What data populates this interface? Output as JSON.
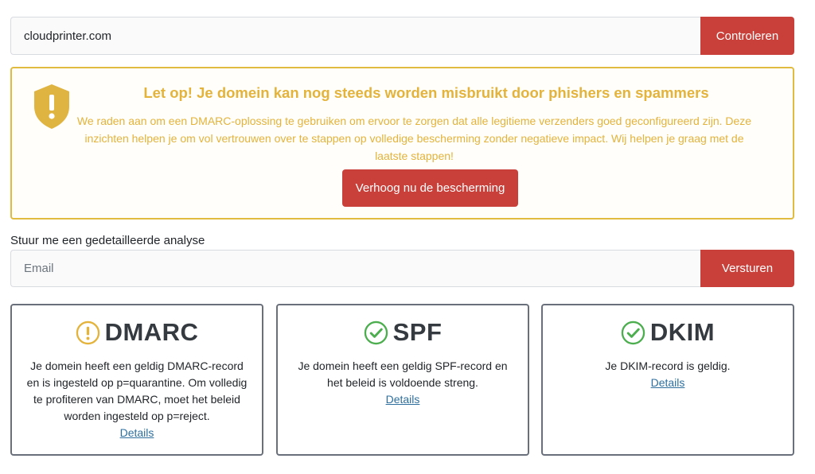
{
  "search": {
    "domain_value": "cloudprinter.com",
    "check_label": "Controleren"
  },
  "warning": {
    "icon": "shield-exclamation-icon",
    "title": "Let op! Je domein kan nog steeds worden misbruikt door phishers en spammers",
    "body": "We raden aan om een DMARC-oplossing te gebruiken om ervoor te zorgen dat alle legitieme verzenders goed geconfigureerd zijn. Deze inzichten helpen je om vol vertrouwen over te stappen op volledige bescherming zonder negatieve impact. Wij helpen je graag met de laatste stappen!",
    "cta_label": "Verhoog nu de bescherming",
    "color": "#e3b33b"
  },
  "analysis": {
    "label": "Stuur me een gedetailleerde analyse",
    "email_placeholder": "Email",
    "send_label": "Versturen"
  },
  "cards": [
    {
      "name": "DMARC",
      "status_icon": "warning-circle-icon",
      "status_color": "#e3b33b",
      "text": "Je domein heeft een geldig DMARC-record en is ingesteld op p=quarantine. Om volledig te profiteren van DMARC, moet het beleid worden ingesteld op p=reject.",
      "link": "Details"
    },
    {
      "name": "SPF",
      "status_icon": "check-circle-icon",
      "status_color": "#4cae4f",
      "text": "Je domein heeft een geldig SPF-record en het beleid is voldoende streng.",
      "link": "Details"
    },
    {
      "name": "DKIM",
      "status_icon": "check-circle-icon",
      "status_color": "#4cae4f",
      "text": "Je DKIM-record is geldig.",
      "link": "Details"
    }
  ],
  "colors": {
    "button": "#c9403a",
    "card_border": "#6a707b",
    "link": "#2e6f9e"
  }
}
